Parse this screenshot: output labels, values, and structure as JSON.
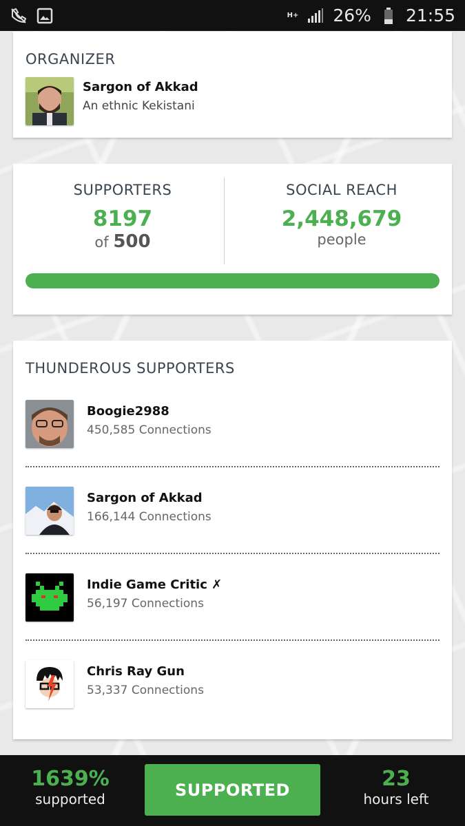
{
  "status_bar": {
    "network": "H+",
    "battery": "26%",
    "time": "21:55"
  },
  "organizer": {
    "heading": "ORGANIZER",
    "name": "Sargon of Akkad",
    "tagline": "An ethnic Kekistani"
  },
  "stats": {
    "supporters_label": "SUPPORTERS",
    "supporters_value": "8197",
    "supporters_of": "of",
    "supporters_goal": "500",
    "reach_label": "SOCIAL REACH",
    "reach_value": "2,448,679",
    "reach_unit": "people",
    "progress_fraction": 1.0
  },
  "thunderous": {
    "heading": "THUNDEROUS SUPPORTERS",
    "items": [
      {
        "name": "Boogie2988",
        "connections": "450,585 Connections"
      },
      {
        "name": "Sargon of Akkad",
        "connections": "166,144 Connections"
      },
      {
        "name": "Indie Game Critic ✗",
        "connections": "56,197 Connections"
      },
      {
        "name": "Chris Ray Gun",
        "connections": "53,337 Connections"
      }
    ]
  },
  "bottom_bar": {
    "percent_value": "1639%",
    "percent_label": "supported",
    "button_label": "SUPPORTED",
    "time_value": "23",
    "time_label": "hours left"
  },
  "colors": {
    "accent": "#4caf50",
    "heading": "#3a4550"
  }
}
